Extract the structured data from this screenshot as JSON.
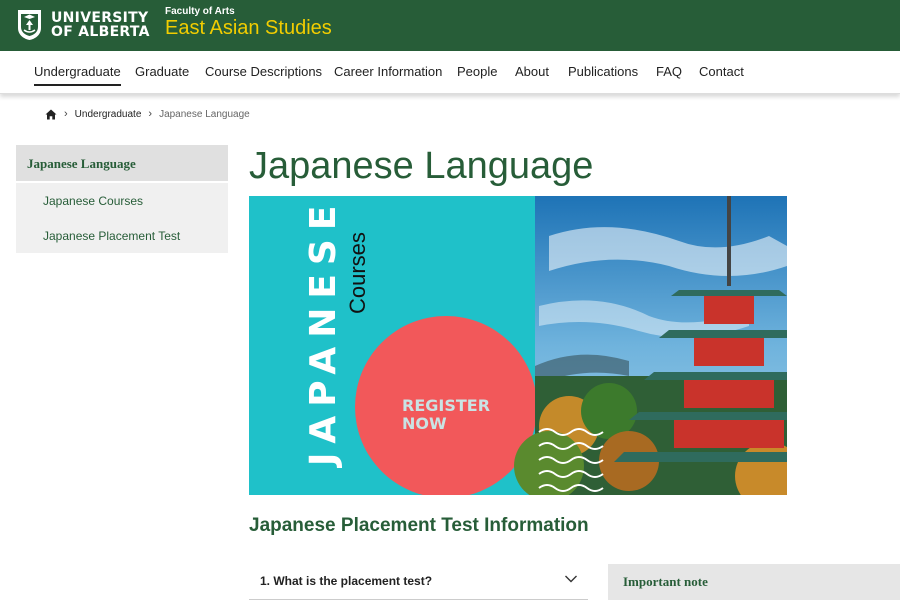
{
  "header": {
    "logo_line1": "UNIVERSITY",
    "logo_line2": "OF ALBERTA",
    "faculty": "Faculty of Arts",
    "department": "East Asian Studies",
    "colors": {
      "brand_green": "#275d38",
      "brand_gold": "#f2cd00"
    }
  },
  "nav": {
    "items": [
      {
        "label": "Undergraduate",
        "active": true
      },
      {
        "label": "Graduate"
      },
      {
        "label": "Course Descriptions"
      },
      {
        "label": "Career Information"
      },
      {
        "label": "People"
      },
      {
        "label": "About"
      },
      {
        "label": "Publications"
      },
      {
        "label": "FAQ"
      },
      {
        "label": "Contact"
      }
    ]
  },
  "breadcrumb": {
    "home_icon": "home-icon",
    "items": [
      "Undergraduate",
      "Japanese Language"
    ]
  },
  "sidebar": {
    "heading": "Japanese Language",
    "items": [
      {
        "label": "Japanese Courses"
      },
      {
        "label": "Japanese Placement Test"
      }
    ]
  },
  "main": {
    "title": "Japanese Language",
    "banner": {
      "word_main": "JAPANESE",
      "word_sub": "Courses",
      "cta_line1": "REGISTER",
      "cta_line2": "NOW",
      "colors": {
        "teal": "#1fc1c9",
        "coral": "#f2585a"
      }
    },
    "section_title": "Japanese Placement Test Information",
    "accordion": [
      {
        "label": "1. What is the placement test?",
        "icon": "chevron-down-icon"
      }
    ],
    "note_heading": "Important note"
  }
}
